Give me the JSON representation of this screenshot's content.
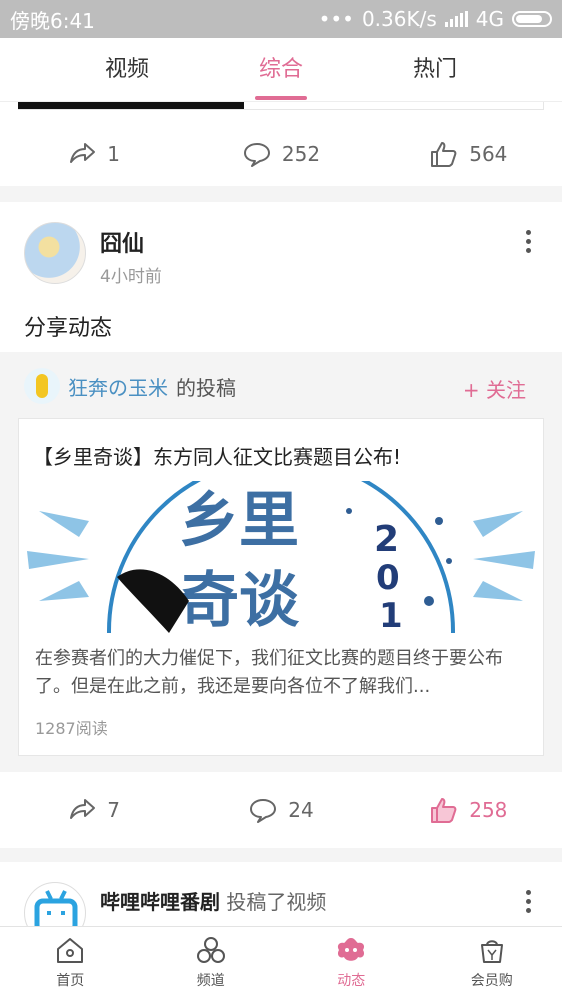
{
  "status_bar": {
    "time": "傍晚6:41",
    "network_speed": "0.36K/s",
    "network_type": "4G",
    "dots": "•••"
  },
  "tabs": [
    {
      "label": "视频",
      "active": false
    },
    {
      "label": "综合",
      "active": true
    },
    {
      "label": "热门",
      "active": false
    }
  ],
  "prev_post": {
    "share_count": "1",
    "comment_count": "252",
    "like_count": "564"
  },
  "post": {
    "author": "囧仙",
    "time_ago": "4小时前",
    "text": "分享动态",
    "shared": {
      "user": "狂奔の玉米",
      "suffix": "的投稿",
      "follow_label": "+ 关注",
      "article_title": "【乡里奇谈】东方同人征文比赛题目公布!",
      "excerpt": "在参赛者们的大力催促下，我们征文比赛的题目终于要公布了。但是在此之前，我还是要向各位不了解我们...",
      "reads": "1287阅读"
    },
    "share_count": "7",
    "comment_count": "24",
    "like_count": "258"
  },
  "next_post": {
    "author": "哔哩哔哩番剧",
    "action": "投稿了视频"
  },
  "bottom_nav": [
    {
      "label": "首页",
      "icon": "home-icon",
      "active": false
    },
    {
      "label": "频道",
      "icon": "channel-icon",
      "active": false
    },
    {
      "label": "动态",
      "icon": "dynamic-icon",
      "active": true
    },
    {
      "label": "会员购",
      "icon": "shopping-bag-icon",
      "active": false
    }
  ],
  "colors": {
    "accent": "#e06c94",
    "link": "#4a90c2"
  }
}
